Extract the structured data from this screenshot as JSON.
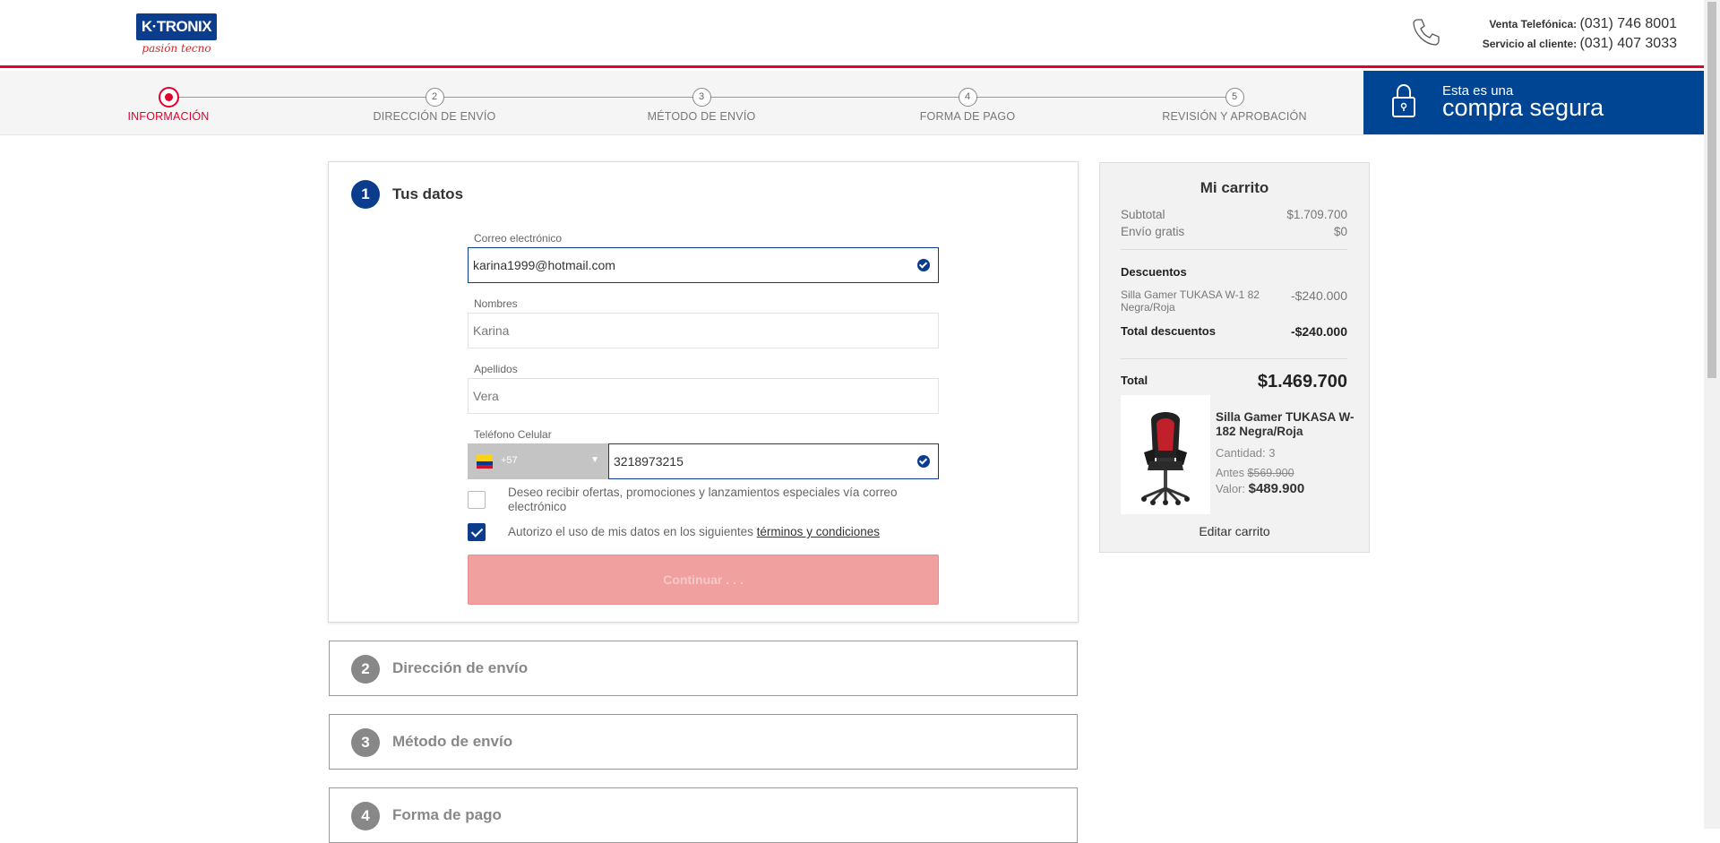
{
  "header": {
    "logo_text": "K·TRONIX",
    "logo_tagline": "pasión tecno",
    "phone_sales_label": "Venta Telefónica:",
    "phone_sales_number": "(031) 746 8001",
    "phone_service_label": "Servicio al cliente:",
    "phone_service_number": "(031) 407 3033"
  },
  "steps": [
    {
      "num": "1",
      "label": "INFORMACIÓN",
      "active": true
    },
    {
      "num": "2",
      "label": "DIRECCIÓN DE ENVÍO"
    },
    {
      "num": "3",
      "label": "MÉTODO DE ENVÍO"
    },
    {
      "num": "4",
      "label": "FORMA DE PAGO"
    },
    {
      "num": "5",
      "label": "REVISIÓN Y APROBACIÓN"
    }
  ],
  "secure": {
    "line1": "Esta es una",
    "line2": "compra segura"
  },
  "form": {
    "section_num": "1",
    "title": "Tus datos",
    "email_label": "Correo electrónico",
    "email_value": "karina1999@hotmail.com",
    "names_label": "Nombres",
    "names_value": "Karina",
    "lastnames_label": "Apellidos",
    "lastnames_value": "Vera",
    "phone_label": "Teléfono Celular",
    "country_code": "+57",
    "phone_value": "3218973215",
    "offers_text": "Deseo recibir ofertas, promociones y lanzamientos especiales vía correo electrónico",
    "terms_text": "Autorizo el uso de mis datos en los siguientes",
    "terms_link": "términos y condiciones",
    "continue_label": "Continuar . . ."
  },
  "sections": [
    {
      "num": "2",
      "title": "Dirección de envío"
    },
    {
      "num": "3",
      "title": "Método de envío"
    },
    {
      "num": "4",
      "title": "Forma de pago"
    }
  ],
  "cart": {
    "title": "Mi carrito",
    "subtotal_label": "Subtotal",
    "subtotal_value": "$1.709.700",
    "shipping_label": "Envío gratis",
    "shipping_value": "$0",
    "discounts_heading": "Descuentos",
    "discount_item_label": "Silla Gamer TUKASA W-1 82 Negra/Roja",
    "discount_item_value": "-$240.000",
    "total_discounts_label": "Total descuentos",
    "total_discounts_value": "-$240.000",
    "total_label": "Total",
    "total_value": "$1.469.700",
    "product_name": "Silla Gamer TUKASA W-182 Negra/Roja",
    "product_qty": "Cantidad: 3",
    "product_before_label": "Antes",
    "product_before_value": "$569.900",
    "product_value_label": "Valor:",
    "product_value": "$489.900",
    "edit_label": "Editar carrito"
  },
  "colors": {
    "brand_blue": "#0b3d8c",
    "brand_red": "#e4002b",
    "secure_blue": "#004494"
  }
}
